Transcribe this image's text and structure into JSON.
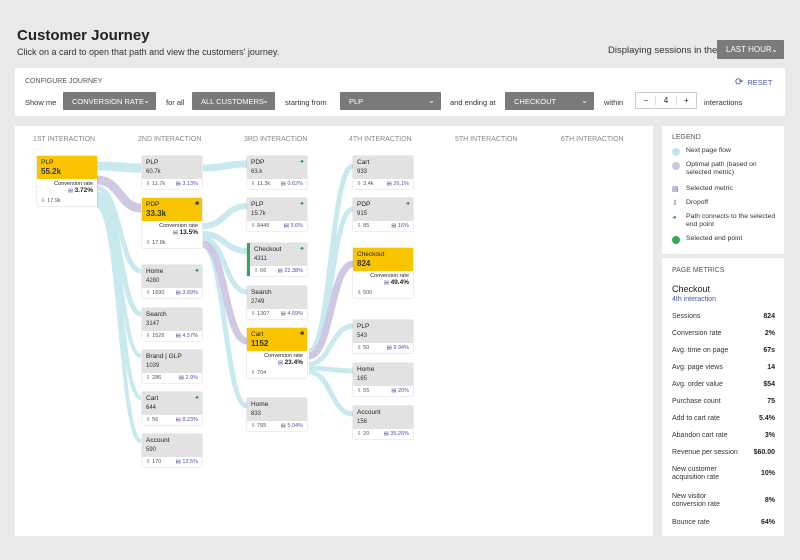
{
  "header": {
    "title": "Customer Journey",
    "subtitle": "Click on a card to open that path and view the customers' journey.",
    "displaying_label": "Displaying sessions in the",
    "time_range": "LAST HOUR"
  },
  "config": {
    "title": "CONFIGURE JOURNEY",
    "reset": "RESET",
    "show_me": "Show me",
    "metric": "CONVERSION RATE",
    "for_all": "for all",
    "segment": "ALL CUSTOMERS",
    "starting_from": "starting from",
    "start_page": "PLP",
    "ending_at": "and ending at",
    "end_page": "CHECKOUT",
    "within": "within",
    "stepper_minus": "−",
    "stepper_value": "4",
    "stepper_plus": "+",
    "interactions": "interactions"
  },
  "columns": [
    "1ST INTERACTION",
    "2ND INTERACTION",
    "3RD INTERACTION",
    "4TH INTERACTION",
    "5TH INTERACTION",
    "6TH INTERACTION"
  ],
  "cards": {
    "c1": [
      {
        "name": "PLP",
        "value": "55.2k",
        "conv_label": "Conversion rate",
        "conv": "3.72%",
        "drop": "17.9k"
      }
    ],
    "c2": [
      {
        "name": "PLP",
        "value": "60.7k",
        "drop": "11.7k",
        "metric": "3.13%"
      },
      {
        "name": "PDP",
        "value": "33.3k",
        "conv_label": "Conversion rate",
        "conv": "13.5%",
        "drop": "17.8k"
      },
      {
        "name": "Home",
        "value": "4280",
        "drop": "1690",
        "metric": "3.69%"
      },
      {
        "name": "Search",
        "value": "3147",
        "drop": "1526",
        "metric": "4.57%"
      },
      {
        "name": "Brand | GLP",
        "value": "1039",
        "drop": "286",
        "metric": "2.9%"
      },
      {
        "name": "Cart",
        "value": "644",
        "drop": "56",
        "metric": "8.23%"
      },
      {
        "name": "Account",
        "value": "590",
        "drop": "170",
        "metric": "12.5%"
      }
    ],
    "c3": [
      {
        "name": "PDP",
        "value": "63.k",
        "drop": "11.3k",
        "metric": "0.62%"
      },
      {
        "name": "PLP",
        "value": "15.7k",
        "drop": "8445",
        "metric": "3.6%"
      },
      {
        "name": "Checkout",
        "value": "4311",
        "drop": "66",
        "metric": "22.38%"
      },
      {
        "name": "Search",
        "value": "2749",
        "drop": "1307",
        "metric": "4.69%"
      },
      {
        "name": "Cart",
        "value": "1152",
        "conv_label": "Conversion rate",
        "conv": "23.4%",
        "drop": "704"
      },
      {
        "name": "Home",
        "value": "833",
        "drop": "765",
        "metric": "5.04%"
      }
    ],
    "c4": [
      {
        "name": "Cart",
        "value": "933",
        "drop": "3.4k",
        "metric": "26.1%"
      },
      {
        "name": "PDP",
        "value": "915",
        "drop": "85",
        "metric": "16%"
      },
      {
        "name": "Checkout",
        "value": "824",
        "conv_label": "Conversion rate",
        "conv": "49.4%",
        "drop": "500"
      },
      {
        "name": "PLP",
        "value": "543",
        "drop": "50",
        "metric": "9.94%"
      },
      {
        "name": "Home",
        "value": "165",
        "drop": "55",
        "metric": "20%"
      },
      {
        "name": "Account",
        "value": "156",
        "drop": "20",
        "metric": "35.26%"
      }
    ]
  },
  "legend": {
    "title": "LEGEND",
    "items": [
      "Next page flow",
      "Optimal path (based on selected metric)",
      "Selected metric",
      "Dropoff",
      "Path connects to the selected end point",
      "Selected end point"
    ],
    "colors": {
      "flow": "#bfe6ea",
      "optimal": "#cdc6e3",
      "end": "#35a854"
    }
  },
  "metrics": {
    "title": "PAGE METRICS",
    "name": "Checkout",
    "sub": "4th interaction",
    "rows": [
      {
        "label": "Sessions",
        "value": "824"
      },
      {
        "label": "Conversion rate",
        "value": "2%"
      },
      {
        "label": "Avg. time on page",
        "value": "67s"
      },
      {
        "label": "Avg. page views",
        "value": "14"
      },
      {
        "label": "Avg. order value",
        "value": "$54"
      },
      {
        "label": "Purchase count",
        "value": "75"
      },
      {
        "label": "Add to cart rate",
        "value": "5.4%"
      },
      {
        "label": "Abandon cart rate",
        "value": "3%"
      },
      {
        "label": "Revenue per session",
        "value": "$60.00"
      },
      {
        "label": "New customer acquisition rate",
        "value": "10%"
      },
      {
        "label": "New visitor conversion rate",
        "value": "8%"
      },
      {
        "label": "Bounce rate",
        "value": "64%"
      }
    ]
  }
}
